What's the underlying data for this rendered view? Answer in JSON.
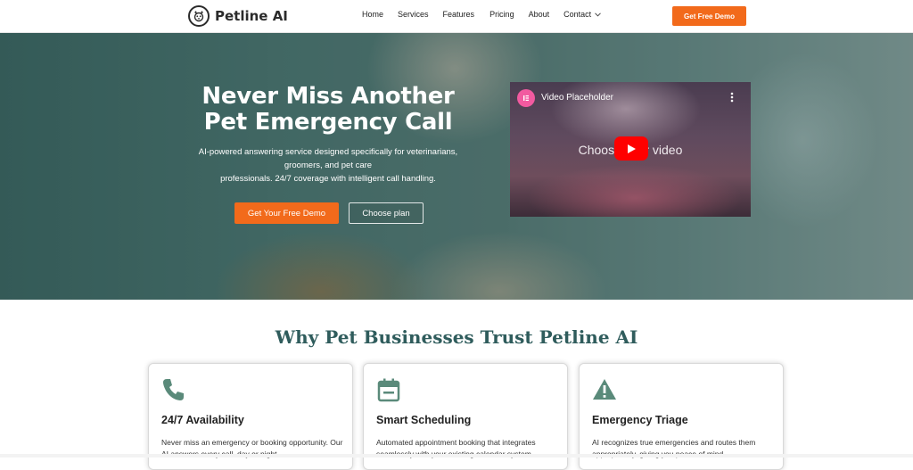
{
  "nav": {
    "brand": "Petline AI",
    "items": [
      {
        "label": "Home"
      },
      {
        "label": "Services"
      },
      {
        "label": "Features"
      },
      {
        "label": "Pricing"
      },
      {
        "label": "About"
      },
      {
        "label": "Contact"
      }
    ],
    "cta_label": "Get Free Demo",
    "icons": {
      "logo": "dog-face-icon",
      "contact_caret": "chevron-down-icon"
    }
  },
  "hero": {
    "title": "Never Miss Another Pet Emergency Call",
    "subtitle_lines": [
      "AI-powered answering service designed specifically for veterinarians,",
      "groomers, and pet care",
      "professionals. 24/7 coverage with intelligent call handling."
    ],
    "primary_button": "Get Your Free Demo",
    "secondary_button": "Choose plan"
  },
  "video": {
    "title": "Video Placeholder",
    "background_text": "Choose your video",
    "icons": {
      "brand": "elementor-icon",
      "menu": "kebab-menu-icon",
      "play": "play-icon"
    }
  },
  "features": {
    "heading": "Why Pet Businesses Trust Petline AI",
    "cards": [
      {
        "icon": "phone-icon",
        "title": "24/7 Availability",
        "text": "Never miss an emergency or booking opportunity. Our AI answers every call, day or night."
      },
      {
        "icon": "calendar-icon",
        "title": "Smart Scheduling",
        "text": "Automated appointment booking that integrates seamlessly with your existing calendar system."
      },
      {
        "icon": "warning-icon",
        "title": "Emergency Triage",
        "text": "AI recognizes true emergencies and routes them appropriately, giving you peace of mind."
      }
    ]
  },
  "colors": {
    "accent_orange": "#f26a1b",
    "heading_teal": "#2f5c5c",
    "icon_green": "#5a8a7a",
    "youtube_red": "#ff0000"
  }
}
